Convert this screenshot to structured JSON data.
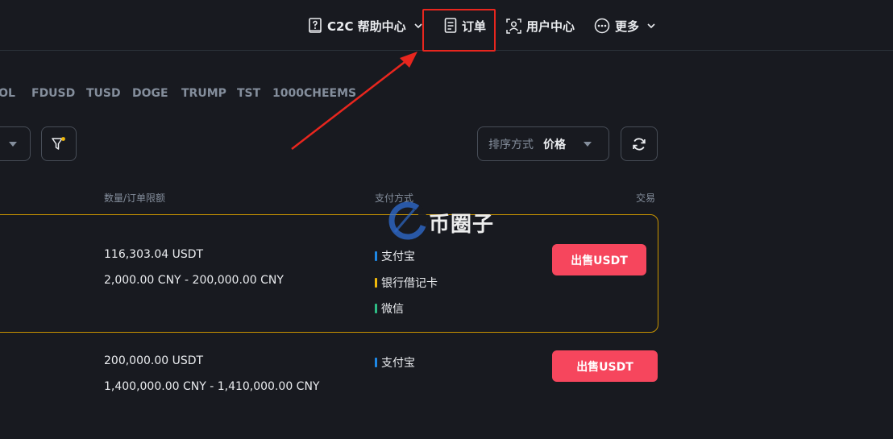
{
  "nav": {
    "help_label": "C2C 帮助中心",
    "orders_label": "订单",
    "user_center_label": "用户中心",
    "more_label": "更多"
  },
  "coin_tabs": [
    "SOL",
    "FDUSD",
    "TUSD",
    "DOGE",
    "TRUMP",
    "TST",
    "1000CHEEMS"
  ],
  "sort": {
    "label": "排序方式",
    "value": "价格"
  },
  "table": {
    "headers": {
      "quantity": "数量/订单限额",
      "payment": "支付方式",
      "trade": "交易"
    },
    "rows": [
      {
        "quantity": "116,303.04 USDT",
        "limit": "2,000.00 CNY - 200,000.00 CNY",
        "payments": [
          {
            "name": "支付宝",
            "color": "#1e88e5"
          },
          {
            "name": "银行借记卡",
            "color": "#f0b90b"
          },
          {
            "name": "微信",
            "color": "#2ebd85"
          }
        ],
        "action": "出售USDT",
        "highlighted": true
      },
      {
        "quantity": "200,000.00 USDT",
        "limit": "1,400,000.00 CNY - 1,410,000.00 CNY",
        "payments": [
          {
            "name": "支付宝",
            "color": "#1e88e5"
          }
        ],
        "action": "出售USDT",
        "highlighted": false
      }
    ]
  },
  "watermark": {
    "text": "币圈子"
  },
  "colors": {
    "background": "#181a20",
    "sell": "#f6465d",
    "highlight_border": "#c99400",
    "annotation": "#e8261e"
  }
}
